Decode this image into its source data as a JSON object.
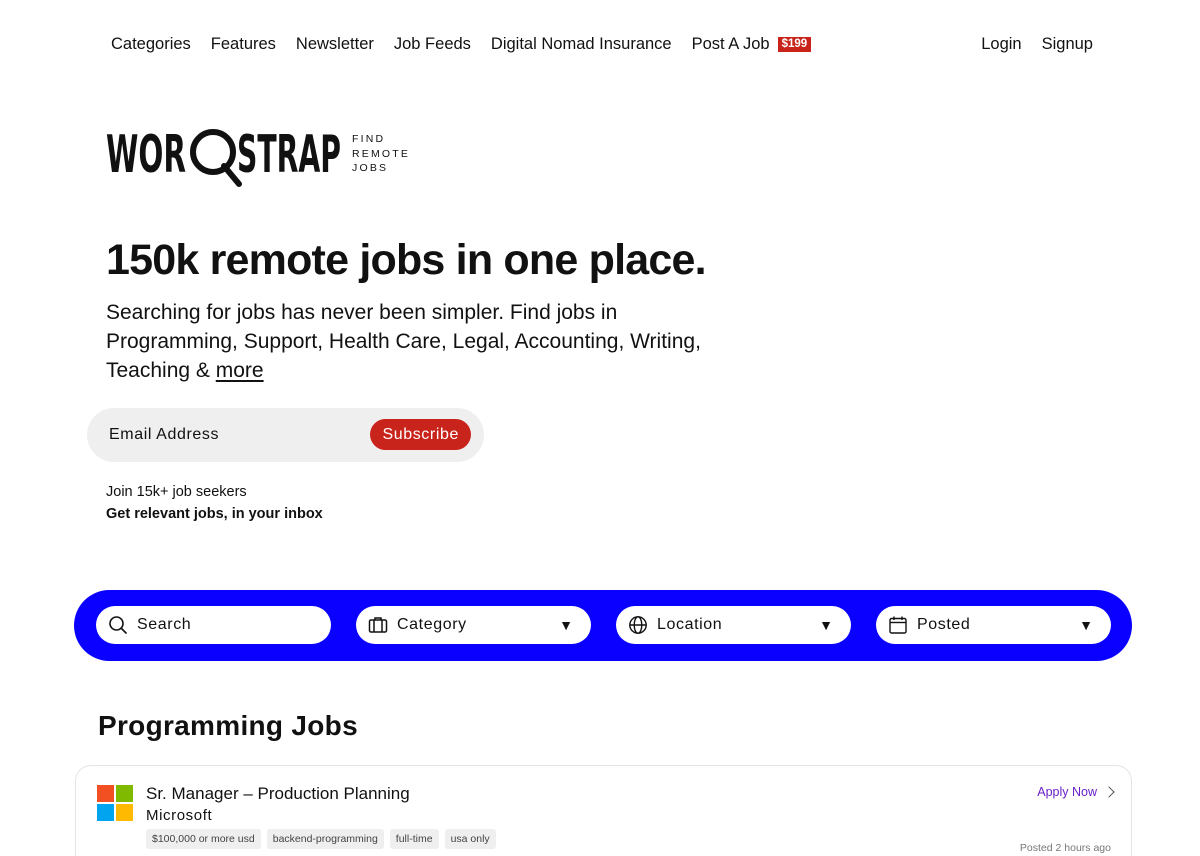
{
  "nav": {
    "items": [
      {
        "label": "Categories"
      },
      {
        "label": "Features"
      },
      {
        "label": "Newsletter"
      },
      {
        "label": "Job Feeds"
      },
      {
        "label": "Digital Nomad Insurance"
      }
    ],
    "post_job": {
      "label": "Post A Job",
      "price": "$199"
    },
    "login": "Login",
    "signup": "Signup"
  },
  "logo": {
    "wordmark": "WORQSTRAP",
    "tagline": [
      "FIND",
      "REMOTE",
      "JOBS"
    ]
  },
  "hero": {
    "title": "150k remote jobs in one place.",
    "subtitle": "Searching for jobs has never been simpler. Find jobs in Programming, Support, Health Care, Legal, Accounting, Writing, Teaching & ",
    "more_link": "more"
  },
  "subscribe": {
    "placeholder": "Email Address",
    "button": "Subscribe",
    "join_text": "Join 15k+ job seekers",
    "cta_text": "Get relevant jobs, in your inbox"
  },
  "filters": {
    "search": {
      "label": "Search",
      "icon": "search-icon"
    },
    "category": {
      "label": "Category",
      "icon": "briefcase-icon"
    },
    "location": {
      "label": "Location",
      "icon": "globe-icon"
    },
    "posted": {
      "label": "Posted",
      "icon": "calendar-icon"
    },
    "arrow": "▼"
  },
  "colors": {
    "accent_blue": "#0a00ff",
    "accent_red": "#c8241b",
    "apply_purple": "#6b21c8"
  },
  "section": {
    "title": "Programming Jobs"
  },
  "jobs": [
    {
      "title": "Sr. Manager – Production Planning",
      "company": "Microsoft",
      "tags": [
        "$100,000 or more usd",
        "backend-programming",
        "full-time",
        "usa only"
      ],
      "apply": "Apply Now",
      "posted": "Posted 2 hours ago"
    }
  ]
}
